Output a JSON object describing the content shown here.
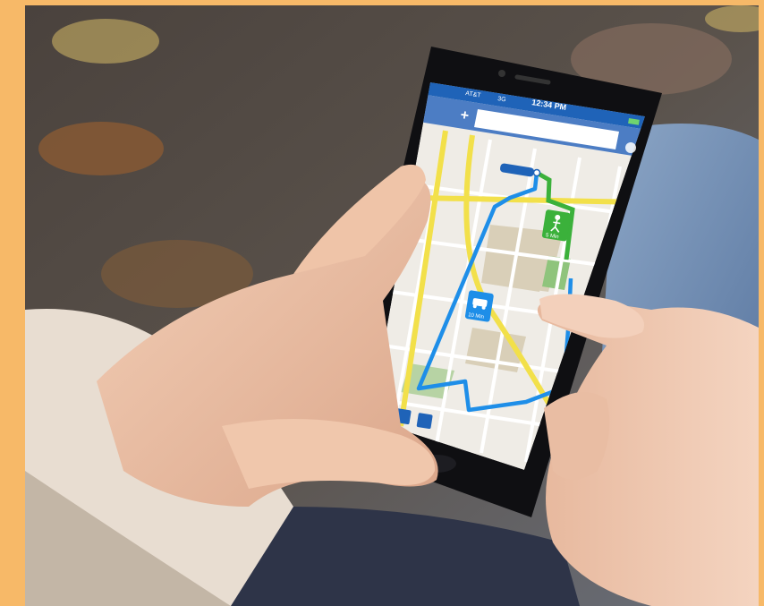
{
  "phone": {
    "carrier": "AT&T",
    "network": "3G",
    "time": "12:34 PM",
    "search_value": "",
    "location_label": "",
    "walk_duration": "5 Min",
    "car_duration": "10 Min"
  },
  "route_colors": {
    "driving": "#1e8ee8",
    "walking": "#3bb13b",
    "major_road": "#f2e04a"
  },
  "icons": {
    "add": "plus-icon",
    "walk": "pedestrian-icon",
    "car": "car-icon",
    "locate": "navigation-arrow-icon",
    "settings": "gear-icon"
  }
}
